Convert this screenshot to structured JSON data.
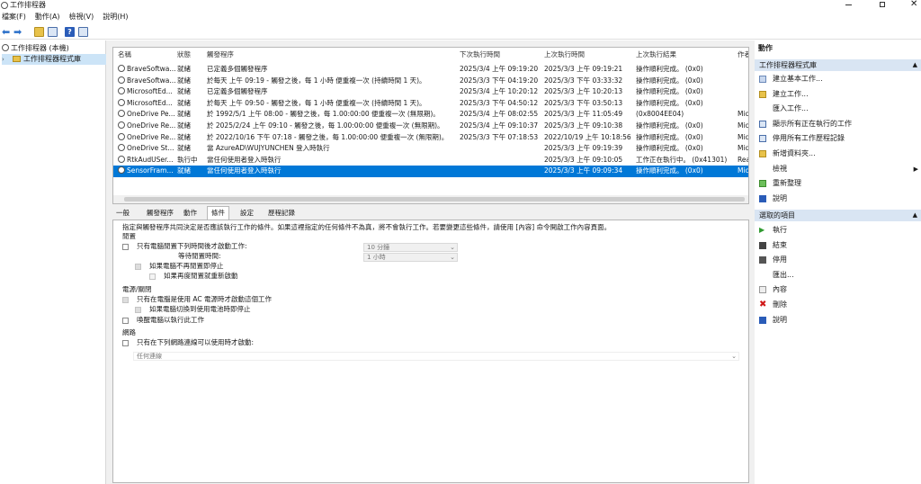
{
  "window": {
    "title": "工作排程器"
  },
  "menu": [
    "檔案(F)",
    "動作(A)",
    "檢視(V)",
    "說明(H)"
  ],
  "tree": {
    "root": "工作排程器 (本機)",
    "child": "工作排程器程式庫"
  },
  "columns": [
    "名稱",
    "狀態",
    "觸發程序",
    "下次執行時間",
    "上次執行時間",
    "上次執行結果",
    "作者"
  ],
  "tasks": [
    {
      "name": "BraveSoftwa...",
      "status": "就緒",
      "trigger": "已定義多個觸發程序",
      "next": "2025/3/4 上午 09:19:20",
      "last": "2025/3/3 上午 09:19:21",
      "result": "操作順利完成。 (0x0)",
      "author": ""
    },
    {
      "name": "BraveSoftwa...",
      "status": "就緒",
      "trigger": "於每天 上午 09:19 - 觸發之後，每 1 小時 便重複一次 (持續時間 1 天)。",
      "next": "2025/3/3 下午 04:19:20",
      "last": "2025/3/3 下午 03:33:32",
      "result": "操作順利完成。 (0x0)",
      "author": ""
    },
    {
      "name": "MicrosoftEd...",
      "status": "就緒",
      "trigger": "已定義多個觸發程序",
      "next": "2025/3/4 上午 10:20:12",
      "last": "2025/3/3 上午 10:20:13",
      "result": "操作順利完成。 (0x0)",
      "author": ""
    },
    {
      "name": "MicrosoftEd...",
      "status": "就緒",
      "trigger": "於每天 上午 09:50 - 觸發之後，每 1 小時 便重複一次 (持續時間 1 天)。",
      "next": "2025/3/3 下午 04:50:12",
      "last": "2025/3/3 下午 03:50:13",
      "result": "操作順利完成。 (0x0)",
      "author": ""
    },
    {
      "name": "OneDrive Pe...",
      "status": "就緒",
      "trigger": "於 1992/5/1 上午 08:00 - 觸發之後，每 1.00:00:00 便重複一次 (無限期)。",
      "next": "2025/3/4 上午 08:02:55",
      "last": "2025/3/3 上午 11:05:49",
      "result": "(0x8004EE04)",
      "author": "Mic"
    },
    {
      "name": "OneDrive Re...",
      "status": "就緒",
      "trigger": "於 2025/2/24 上午 09:10 - 觸發之後，每 1.00:00:00 便重複一次 (無限期)。",
      "next": "2025/3/4 上午 09:10:37",
      "last": "2025/3/3 上午 09:10:38",
      "result": "操作順利完成。 (0x0)",
      "author": "Mic"
    },
    {
      "name": "OneDrive Re...",
      "status": "就緒",
      "trigger": "於 2022/10/16 下午 07:18 - 觸發之後，每 1.00:00:00 便重複一次 (無限期)。",
      "next": "2025/3/3 下午 07:18:53",
      "last": "2022/10/19 上午 10:18:56",
      "result": "操作順利完成。 (0x0)",
      "author": "Mic"
    },
    {
      "name": "OneDrive St...",
      "status": "就緒",
      "trigger": "當 AzureAD\\WUJYUNCHEN 登入時執行",
      "next": "",
      "last": "2025/3/3 上午 09:19:39",
      "result": "操作順利完成。 (0x0)",
      "author": "Mic"
    },
    {
      "name": "RtkAudUSer...",
      "status": "執行中",
      "trigger": "當任何使用者登入時執行",
      "next": "",
      "last": "2025/3/3 上午 09:10:05",
      "result": "工作正在執行中。 (0x41301)",
      "author": "Rea"
    },
    {
      "name": "SensorFram...",
      "status": "就緒",
      "trigger": "當任何使用者登入時執行",
      "next": "",
      "last": "2025/3/3 上午 09:09:34",
      "result": "操作順利完成。 (0x0)",
      "author": "Mic"
    }
  ],
  "tabs": [
    "一般",
    "觸發程序",
    "動作",
    "條件",
    "設定",
    "歷程記錄"
  ],
  "conditions": {
    "intro": "指定與觸發程序共同決定是否應該執行工作的條件。如果這裡指定的任何條件不為真，將不會執行工作。若要變更這些條件，請使用 [內容] 命令開啟工作內容頁面。",
    "idle_group": "閒置",
    "idle_start": "只有電腦閒置下列時間後才啟動工作:",
    "idle_time_value": "10 分鐘",
    "idle_wait_label": "等待閒置時間:",
    "idle_wait_value": "1 小時",
    "idle_stop": "如果電腦不再閒置即停止",
    "idle_restart": "如果再度閒置就重新啟動",
    "power_group": "電源/關閉",
    "power_ac": "只有在電腦是使用 AC 電源時才啟動這個工作",
    "power_battery": "如果電腦切換到使用電池時即停止",
    "power_wake": "喚醒電腦以執行此工作",
    "network_group": "網路",
    "network_start": "只有在下列網路連線可以使用時才啟動:",
    "network_value": "任何連線"
  },
  "actions": {
    "header": "動作",
    "section1": "工作排程器程式庫",
    "items1": [
      "建立基本工作...",
      "建立工作...",
      "匯入工作...",
      "顯示所有正在執行的工作",
      "停用所有工作歷程記錄",
      "新增資料夾...",
      "檢視",
      "重新整理",
      "說明"
    ],
    "section2": "選取的項目",
    "items2": [
      "執行",
      "結束",
      "停用",
      "匯出...",
      "內容",
      "刪除",
      "說明"
    ]
  },
  "colors": {
    "selection": "#0078d7",
    "section_header": "#d9e5f3",
    "panel_bg": "#f0f0f0"
  }
}
